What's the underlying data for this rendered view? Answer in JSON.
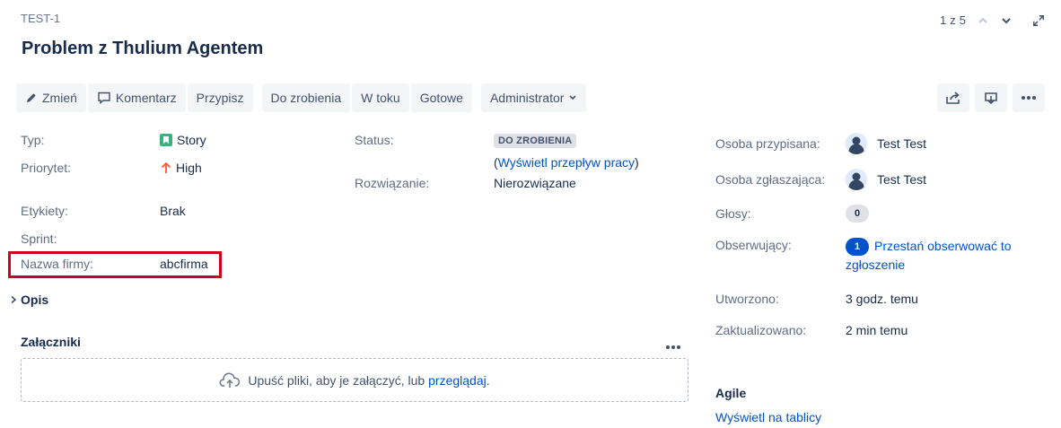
{
  "issue": {
    "key": "TEST-1",
    "title": "Problem z Thulium Agentem"
  },
  "pager": {
    "counter": "1 z 5"
  },
  "toolbar": {
    "edit": "Zmień",
    "comment": "Komentarz",
    "assign": "Przypisz",
    "todo": "Do zrobienia",
    "in_progress": "W toku",
    "done": "Gotowe",
    "admin": "Administrator"
  },
  "details": {
    "type_label": "Typ:",
    "type_value": "Story",
    "priority_label": "Priorytet:",
    "priority_value": "High",
    "labels_label": "Etykiety:",
    "labels_value": "Brak",
    "sprint_label": "Sprint:",
    "company_label": "Nazwa firmy:",
    "company_value": "abcfirma",
    "status_label": "Status:",
    "status_value": "DO ZROBIENIA",
    "workflow_open": "(",
    "workflow_link": "Wyświetl przepływ pracy",
    "workflow_close": ")",
    "resolution_label": "Rozwiązanie:",
    "resolution_value": "Nierozwiązane"
  },
  "description": {
    "title": "Opis"
  },
  "attachments": {
    "title": "Załączniki",
    "drop_text": "Upuść pliki, aby je załączyć, lub",
    "browse_link": "przeglądaj."
  },
  "people": {
    "assignee_label": "Osoba przypisana:",
    "assignee_value": "Test Test",
    "reporter_label": "Osoba zgłaszająca:",
    "reporter_value": "Test Test",
    "votes_label": "Głosy:",
    "votes_count": "0",
    "watchers_label": "Obserwujący:",
    "watchers_count": "1",
    "watch_link_line1": "Przestań obserwować to",
    "watch_link_line2": "zgłoszenie"
  },
  "dates": {
    "created_label": "Utworzono:",
    "created_value": "3 godz. temu",
    "updated_label": "Zaktualizowano:",
    "updated_value": "2 min temu"
  },
  "agile": {
    "title": "Agile",
    "board_link": "Wyświetl na tablicy"
  },
  "colors": {
    "highlight": "#d0021b",
    "link": "#0052cc",
    "story_icon": "#36b37e",
    "priority_high": "#ff5630"
  }
}
